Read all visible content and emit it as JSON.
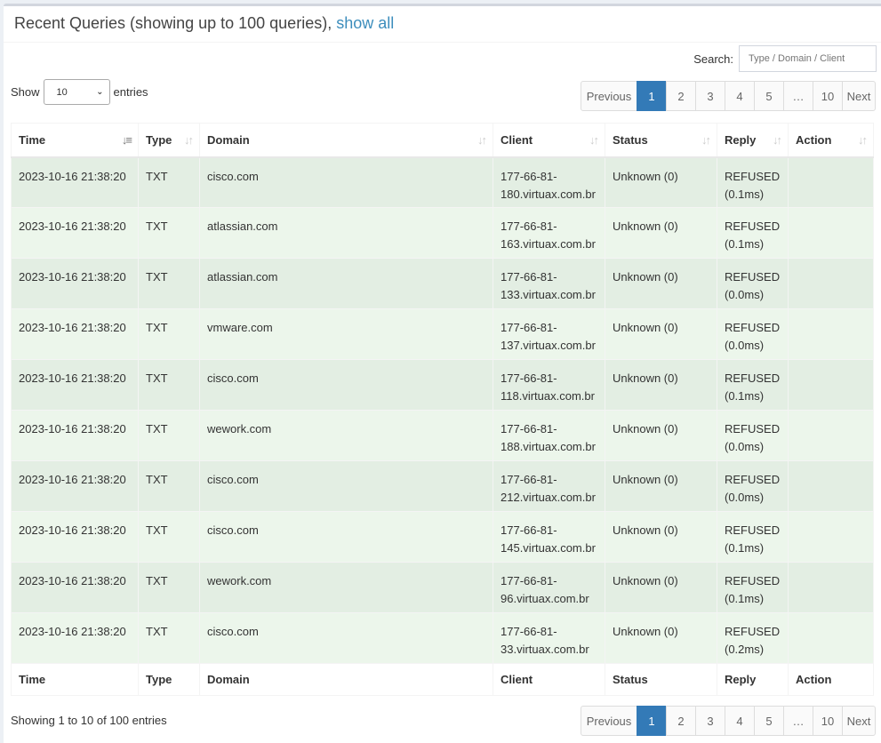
{
  "header": {
    "title": "Recent Queries (showing up to 100 queries),",
    "link": "show all"
  },
  "search": {
    "label": "Search:",
    "placeholder": "Type / Domain / Client"
  },
  "length": {
    "pre": "Show",
    "value": "10",
    "post": "entries"
  },
  "pagination": [
    "Previous",
    "1",
    "2",
    "3",
    "4",
    "5",
    "…",
    "10",
    "Next"
  ],
  "columns": [
    "Time",
    "Type",
    "Domain",
    "Client",
    "Status",
    "Reply",
    "Action"
  ],
  "rows": [
    {
      "time": "2023-10-16 21:38:20",
      "type": "TXT",
      "domain": "cisco.com",
      "client1": "177-66-81-",
      "client2": "180.virtuax.com.br",
      "status": "Unknown (0)",
      "reply1": "REFUSED",
      "reply2": "(0.1ms)"
    },
    {
      "time": "2023-10-16 21:38:20",
      "type": "TXT",
      "domain": "atlassian.com",
      "client1": "177-66-81-",
      "client2": "163.virtuax.com.br",
      "status": "Unknown (0)",
      "reply1": "REFUSED",
      "reply2": "(0.1ms)"
    },
    {
      "time": "2023-10-16 21:38:20",
      "type": "TXT",
      "domain": "atlassian.com",
      "client1": "177-66-81-",
      "client2": "133.virtuax.com.br",
      "status": "Unknown (0)",
      "reply1": "REFUSED",
      "reply2": "(0.0ms)"
    },
    {
      "time": "2023-10-16 21:38:20",
      "type": "TXT",
      "domain": "vmware.com",
      "client1": "177-66-81-",
      "client2": "137.virtuax.com.br",
      "status": "Unknown (0)",
      "reply1": "REFUSED",
      "reply2": "(0.0ms)"
    },
    {
      "time": "2023-10-16 21:38:20",
      "type": "TXT",
      "domain": "cisco.com",
      "client1": "177-66-81-",
      "client2": "118.virtuax.com.br",
      "status": "Unknown (0)",
      "reply1": "REFUSED",
      "reply2": "(0.1ms)"
    },
    {
      "time": "2023-10-16 21:38:20",
      "type": "TXT",
      "domain": "wework.com",
      "client1": "177-66-81-",
      "client2": "188.virtuax.com.br",
      "status": "Unknown (0)",
      "reply1": "REFUSED",
      "reply2": "(0.0ms)"
    },
    {
      "time": "2023-10-16 21:38:20",
      "type": "TXT",
      "domain": "cisco.com",
      "client1": "177-66-81-",
      "client2": "212.virtuax.com.br",
      "status": "Unknown (0)",
      "reply1": "REFUSED",
      "reply2": "(0.0ms)"
    },
    {
      "time": "2023-10-16 21:38:20",
      "type": "TXT",
      "domain": "cisco.com",
      "client1": "177-66-81-",
      "client2": "145.virtuax.com.br",
      "status": "Unknown (0)",
      "reply1": "REFUSED",
      "reply2": "(0.1ms)"
    },
    {
      "time": "2023-10-16 21:38:20",
      "type": "TXT",
      "domain": "wework.com",
      "client1": "177-66-81-",
      "client2": "96.virtuax.com.br",
      "status": "Unknown (0)",
      "reply1": "REFUSED",
      "reply2": "(0.1ms)"
    },
    {
      "time": "2023-10-16 21:38:20",
      "type": "TXT",
      "domain": "cisco.com",
      "client1": "177-66-81-",
      "client2": "33.virtuax.com.br",
      "status": "Unknown (0)",
      "reply1": "REFUSED",
      "reply2": "(0.2ms)"
    }
  ],
  "info": "Showing 1 to 10 of 100 entries"
}
